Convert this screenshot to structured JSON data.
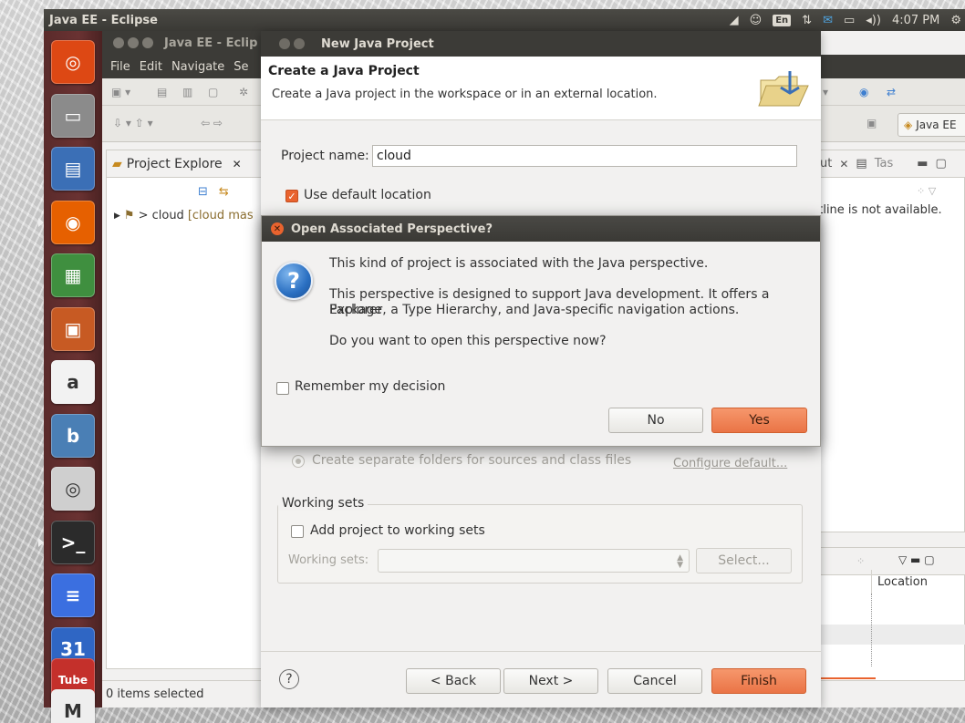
{
  "top_panel": {
    "title": "Java EE - Eclipse",
    "lang": "En",
    "arrows": "⇅",
    "volume": "◂))",
    "time": "4:07 PM"
  },
  "launcher": {
    "items": [
      {
        "name": "ubuntu-dash-icon",
        "glyph": "◎",
        "color": "#dd4814"
      },
      {
        "name": "file-manager-icon",
        "glyph": "▭",
        "color": "#8b8b8b"
      },
      {
        "name": "document-viewer-icon",
        "glyph": "▤",
        "color": "#3b6fb6"
      },
      {
        "name": "firefox-icon",
        "glyph": "◉",
        "color": "#e66000"
      },
      {
        "name": "spreadsheet-icon",
        "glyph": "▦",
        "color": "#3f8f3f"
      },
      {
        "name": "presentation-icon",
        "glyph": "▣",
        "color": "#c75a23"
      },
      {
        "name": "amazon-icon",
        "glyph": "a",
        "color": "#f2f2f2"
      },
      {
        "name": "banshee-icon",
        "glyph": "b",
        "color": "#4a7fb5"
      },
      {
        "name": "speaker-icon",
        "glyph": "◎",
        "color": "#cfcfcf"
      },
      {
        "name": "terminal-icon",
        "glyph": ">_",
        "color": "#2b2b2b"
      },
      {
        "name": "text-editor-icon",
        "glyph": "≡",
        "color": "#3b6fe0"
      },
      {
        "name": "calendar-icon",
        "glyph": "31",
        "color": "#2f66c4"
      },
      {
        "name": "youtube-icon",
        "glyph": "Tube",
        "color": "#c4302b"
      },
      {
        "name": "gmail-icon",
        "glyph": "M",
        "color": "#eeeeee"
      }
    ]
  },
  "eclipse": {
    "window_title": "Java EE - Eclip",
    "menus": [
      "File",
      "Edit",
      "Navigate",
      "Se"
    ],
    "perspective_label": "Java EE",
    "project_explorer_tab": "Project Explore",
    "tree_item_name": "> cloud",
    "tree_item_repo": "[cloud mas",
    "outline_tab": "ut",
    "tasks_tab": "Tas",
    "outline_message": "utline is not available.",
    "location_column": "Location",
    "status_text": "0 items selected"
  },
  "wizard": {
    "title": "New Java Project",
    "header_title": "Create a Java Project",
    "header_desc": "Create a Java project in the workspace or in an external location.",
    "project_name_label": "Project name:",
    "project_name_value": "cloud",
    "use_default_location_label": "Use default location",
    "separate_folders_label": "Create separate folders for sources and class files",
    "configure_default_link": "Configure default...",
    "working_sets_legend": "Working sets",
    "add_to_working_sets_label": "Add project to working sets",
    "working_sets_label": "Working sets:",
    "select_button": "Select...",
    "back_button": "< Back",
    "next_button": "Next >",
    "cancel_button": "Cancel",
    "finish_button": "Finish",
    "help_glyph": "?"
  },
  "dialog": {
    "title": "Open Associated Perspective?",
    "line1": "This kind of project is associated with the Java perspective.",
    "line2a": "This perspective is designed to support Java development. It offers a Package",
    "line2b": "Explorer, a Type Hierarchy, and Java-specific navigation actions.",
    "line3": "Do you want to open this perspective now?",
    "remember_label": "Remember my decision",
    "no_button": "No",
    "yes_button": "Yes",
    "icon_glyph": "?"
  },
  "colors": {
    "accent": "#e9632e",
    "panel_dark": "#3c3b37",
    "launcher": "#5a2b2b"
  }
}
